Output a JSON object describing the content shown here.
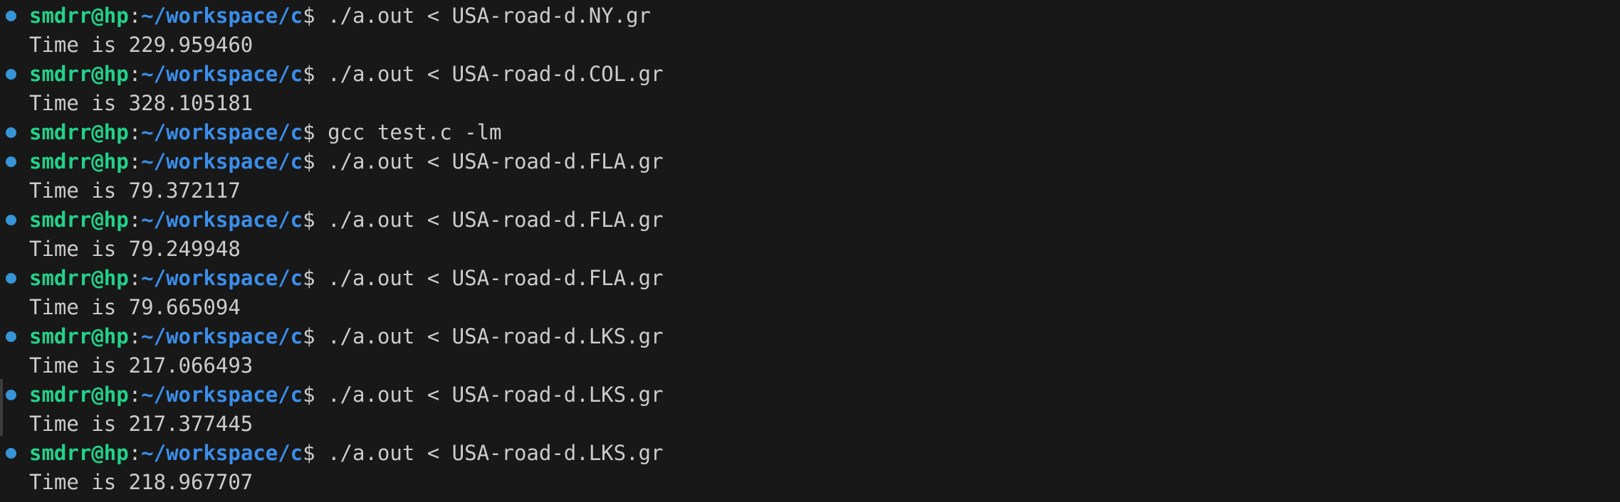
{
  "terminal": {
    "user_host": "smdrr@hp",
    "colon": ":",
    "path": "~/workspace/c",
    "prompt_symbol": "$",
    "colors": {
      "user_host": "#23d18b",
      "path": "#3b8eea",
      "text": "#cccccc",
      "decoration": "#3794d6",
      "background": "#181818"
    },
    "lines": [
      {
        "kind": "command",
        "command": " ./a.out < USA-road-d.NY.gr"
      },
      {
        "kind": "output",
        "text": "Time is 229.959460"
      },
      {
        "kind": "command",
        "command": " ./a.out < USA-road-d.COL.gr"
      },
      {
        "kind": "output",
        "text": "Time is 328.105181"
      },
      {
        "kind": "command",
        "command": " gcc test.c -lm"
      },
      {
        "kind": "command",
        "command": " ./a.out < USA-road-d.FLA.gr"
      },
      {
        "kind": "output",
        "text": "Time is 79.372117"
      },
      {
        "kind": "command",
        "command": " ./a.out < USA-road-d.FLA.gr"
      },
      {
        "kind": "output",
        "text": "Time is 79.249948"
      },
      {
        "kind": "command",
        "command": " ./a.out < USA-road-d.FLA.gr"
      },
      {
        "kind": "output",
        "text": "Time is 79.665094"
      },
      {
        "kind": "command",
        "command": " ./a.out < USA-road-d.LKS.gr"
      },
      {
        "kind": "output",
        "text": "Time is 217.066493"
      },
      {
        "kind": "command",
        "command": " ./a.out < USA-road-d.LKS.gr"
      },
      {
        "kind": "output",
        "text": "Time is 217.377445"
      },
      {
        "kind": "command",
        "command": " ./a.out < USA-road-d.LKS.gr"
      },
      {
        "kind": "output",
        "text": "Time is 218.967707"
      }
    ]
  }
}
